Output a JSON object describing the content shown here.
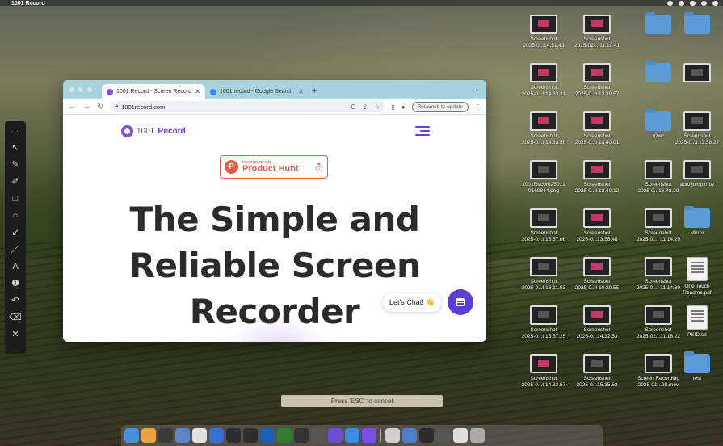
{
  "menubar": {
    "app_name": "1001 Record"
  },
  "browser": {
    "tabs": [
      {
        "title": "1001 Record - Screen Recordi",
        "favicon_color": "#7b4fe0",
        "active": true
      },
      {
        "title": "1001 record - Google Search",
        "favicon_color": "#4285f4",
        "active": false
      }
    ],
    "url": "1001record.com",
    "relaunch_label": "Relaunch to update"
  },
  "page": {
    "logo_number": "1001",
    "logo_word": "Record",
    "badge_small": "FEATURED ON",
    "badge_big": "Product Hunt",
    "badge_votes": "177",
    "headline_lines": [
      "The Simple and",
      "Reliable Screen",
      "Recorder"
    ],
    "chat_label": "Let's Chat! 👋"
  },
  "esc_hint": "Press 'ESC' to cancel",
  "desktop_icons": [
    {
      "label1": "Screenshot",
      "label2": "2025-0...14.51.43",
      "kind": "shot"
    },
    {
      "label1": "Screenshot",
      "label2": "2025-02-...11.10.41",
      "kind": "shot"
    },
    {
      "label1": "",
      "label2": "",
      "kind": "folder"
    },
    {
      "label1": "",
      "label2": "",
      "kind": "folder"
    },
    {
      "label1": "Screenshot",
      "label2": "2025-0...t 14.33.31",
      "kind": "shot"
    },
    {
      "label1": "Screenshot",
      "label2": "2025-0...t 13.39.57",
      "kind": "shot"
    },
    {
      "label1": "",
      "label2": "",
      "kind": "folder"
    },
    {
      "label1": "",
      "label2": "",
      "kind": "dark"
    },
    {
      "label1": "Screenshot",
      "label2": "2025-0...t 14.33.56",
      "kind": "shot"
    },
    {
      "label1": "Screenshot",
      "label2": "2025-0...t 13.40.01",
      "kind": "shot"
    },
    {
      "label1": "qzwc",
      "label2": "",
      "kind": "folder"
    },
    {
      "label1": "Screenshot",
      "label2": "2025-0...t 12.58.27",
      "kind": "dark"
    },
    {
      "label1": "1001Record25021",
      "label2": "9160844.png",
      "kind": "dark"
    },
    {
      "label1": "Screenshot",
      "label2": "2025-0...t 13.40.12",
      "kind": "shot"
    },
    {
      "label1": "Screenshot",
      "label2": "2025-0...16.48.29",
      "kind": "dark"
    },
    {
      "label1": "auto jump.mov",
      "label2": "",
      "kind": "dark"
    },
    {
      "label1": "Screenshot",
      "label2": "2025-0...t 15.57.06",
      "kind": "dark"
    },
    {
      "label1": "Screenshot",
      "label2": "2025-0...13.58.48",
      "kind": "shot"
    },
    {
      "label1": "Screenshot",
      "label2": "2025-0...t 11.14.29",
      "kind": "dark"
    },
    {
      "label1": "Mirror",
      "label2": "",
      "kind": "folder"
    },
    {
      "label1": "Screenshot",
      "label2": "2025-0...t 16.11.03",
      "kind": "dark"
    },
    {
      "label1": "Screenshot",
      "label2": "2025-0...t 10.29.55",
      "kind": "shot"
    },
    {
      "label1": "Screenshot",
      "label2": "2025-0...t 11.14.39",
      "kind": "dark"
    },
    {
      "label1": "One Touch",
      "label2": "Readme.pdf",
      "kind": "doc"
    },
    {
      "label1": "Screenshot",
      "label2": "2025-0...t 15.57.25",
      "kind": "dark"
    },
    {
      "label1": "Screenshot",
      "label2": "2025-0...14.32.53",
      "kind": "shot"
    },
    {
      "label1": "Screenshot",
      "label2": "2025-02...11.18.22",
      "kind": "dark"
    },
    {
      "label1": "PSID.txt",
      "label2": "",
      "kind": "doc"
    },
    {
      "label1": "Screenshot",
      "label2": "2025-0...t 14.32.57",
      "kind": "shot"
    },
    {
      "label1": "Screenshot",
      "label2": "2025-0...15.35.52",
      "kind": "dark"
    },
    {
      "label1": "Screen Recording",
      "label2": "2025-01...28.mov",
      "kind": "dark"
    },
    {
      "label1": "test",
      "label2": "",
      "kind": "folder"
    }
  ],
  "dock_colors": [
    "#4a90d9",
    "#e8a33d",
    "#3a3a3a",
    "#5b87c4",
    "#e0e0e0",
    "#3a6fd0",
    "#2d2d2d",
    "#2d2d2d",
    "#1b5fb0",
    "#2e7d32",
    "#333",
    "#555",
    "#6a4fd0",
    "#3d8be0",
    "#7b4fe0",
    "#cfcfcf",
    "#4c7ec9",
    "#2a2a2a",
    "#555",
    "#ddd",
    "#aaa"
  ],
  "tools": [
    "↖",
    "✎",
    "✐",
    "□",
    "○",
    "↙",
    "／",
    "A",
    "❶",
    "↶",
    "⌫",
    "✕"
  ]
}
